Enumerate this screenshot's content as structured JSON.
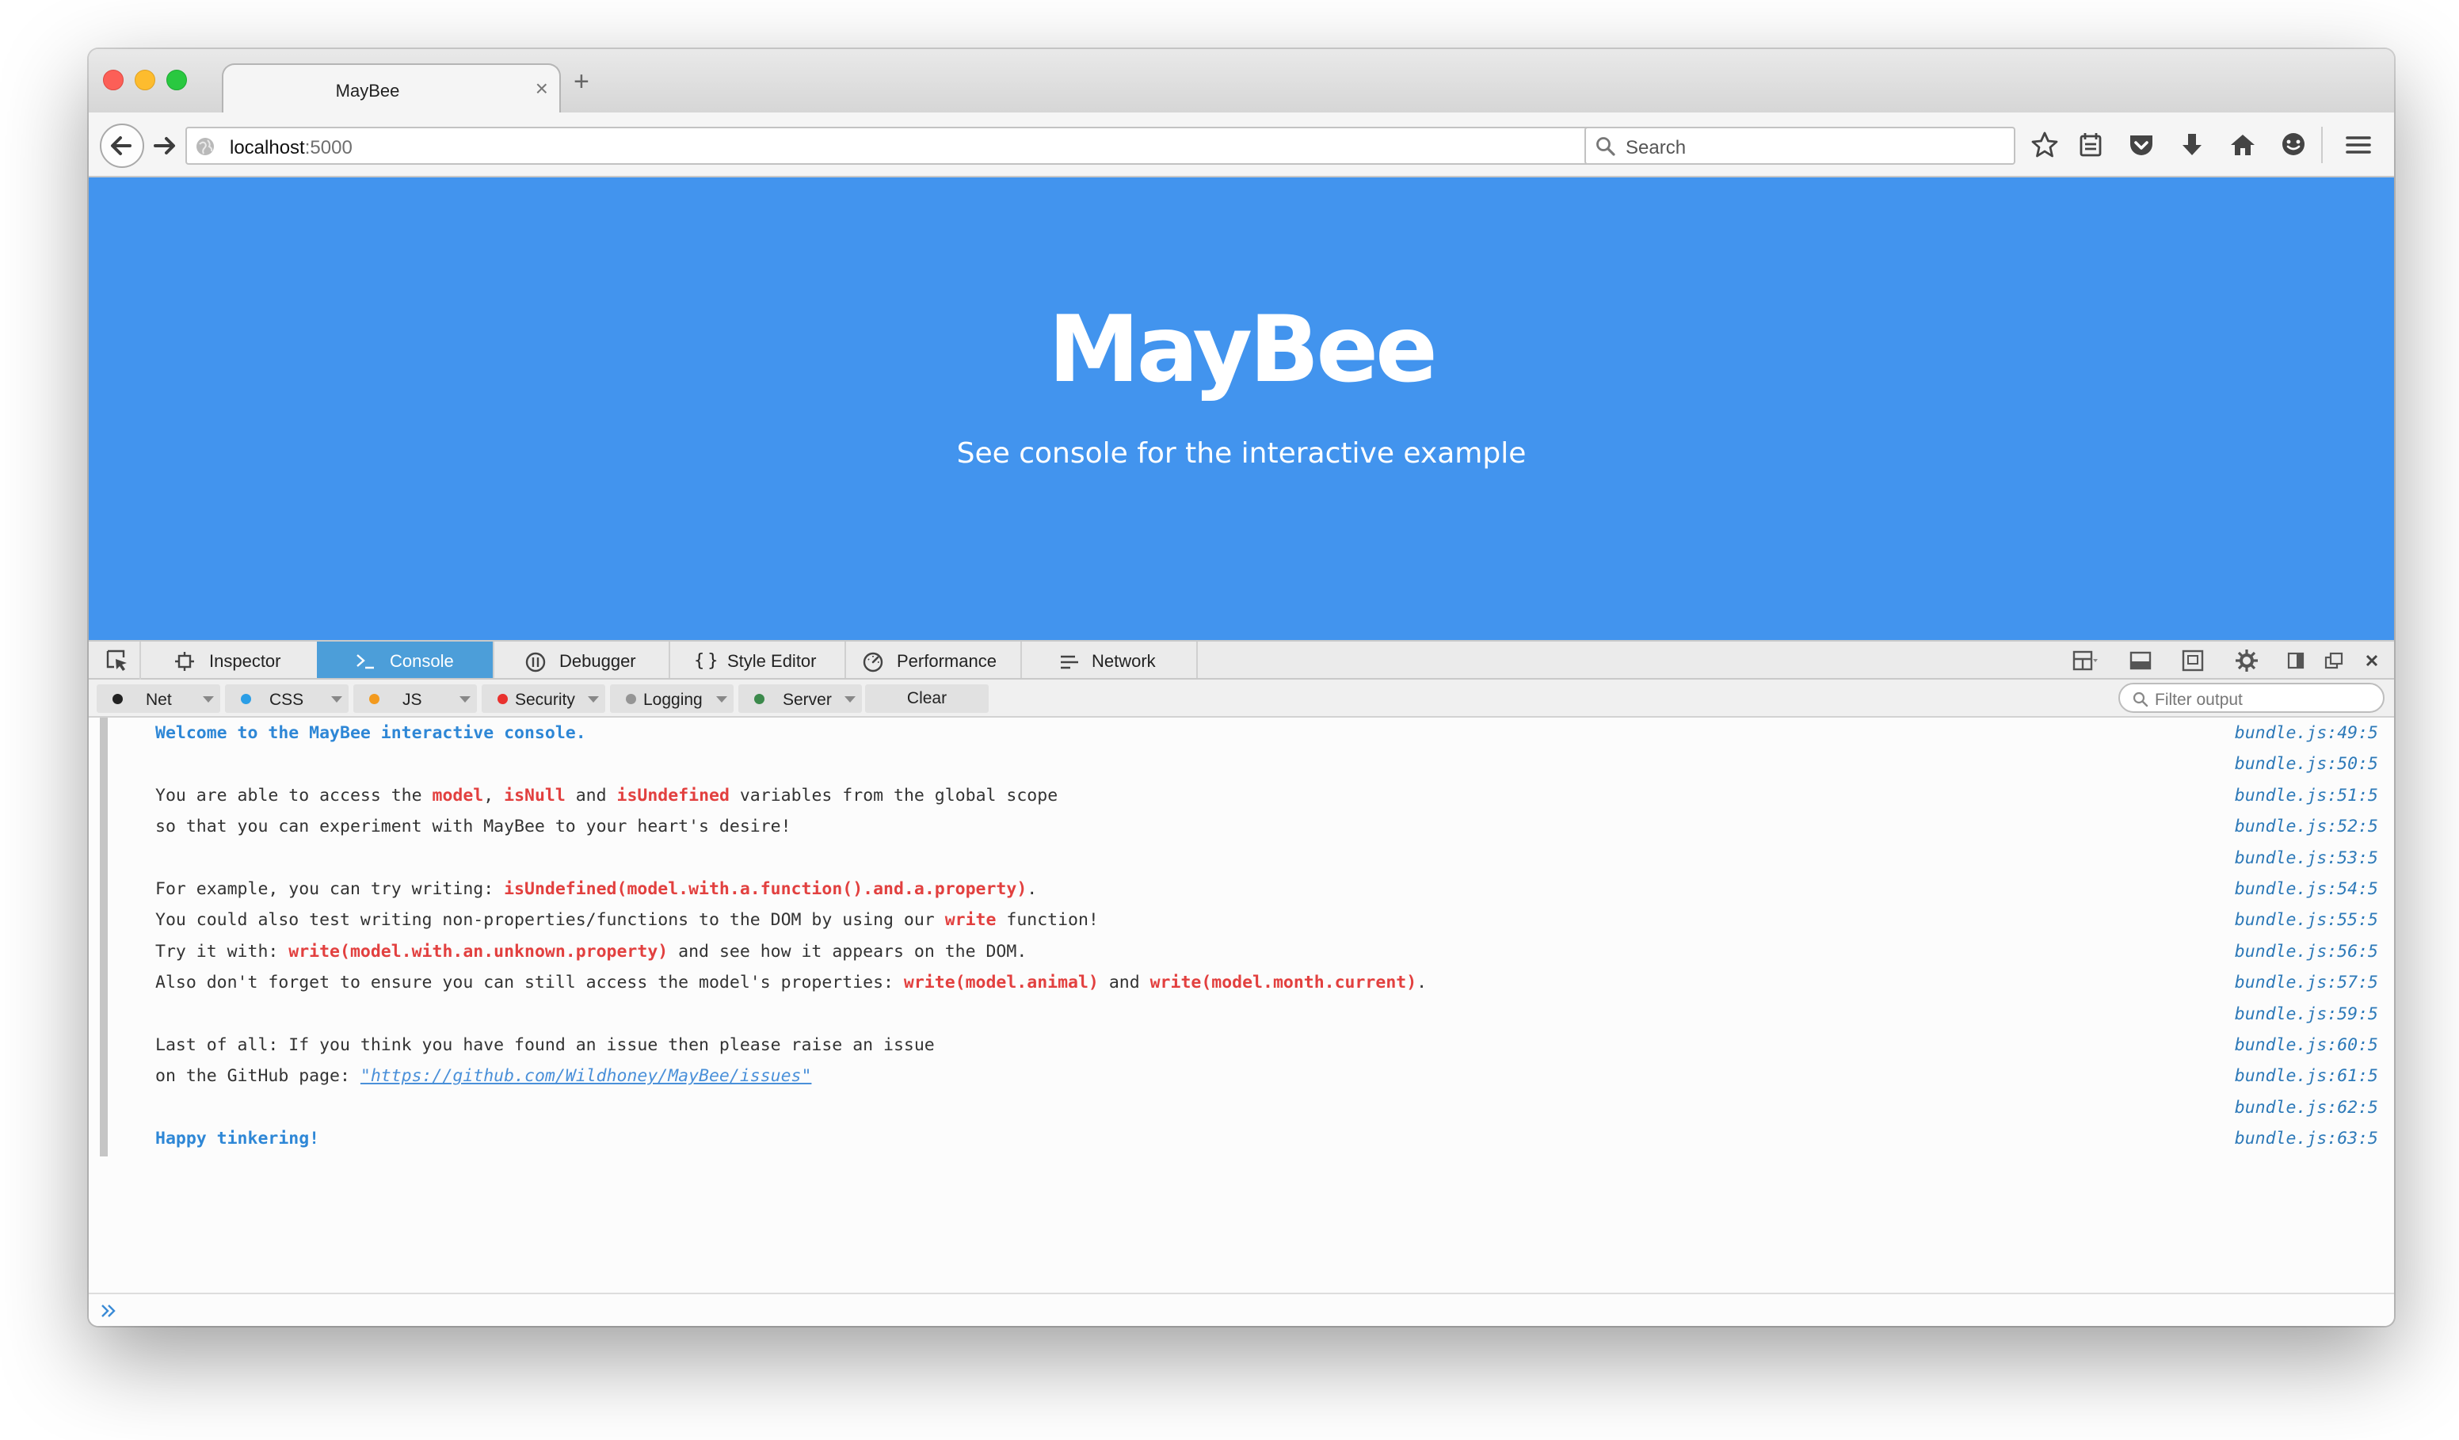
{
  "browser": {
    "tab_title": "MayBee",
    "tab_close": "×",
    "new_tab": "+",
    "url_host": "localhost",
    "url_port": ":5000",
    "search_placeholder": "Search"
  },
  "page": {
    "title": "MayBee",
    "subtitle": "See console for the interactive example"
  },
  "devtools": {
    "tabs": [
      "Inspector",
      "Console",
      "Debugger",
      "Style Editor",
      "Performance",
      "Network"
    ],
    "active_tab": "Console",
    "filters": [
      "Net",
      "CSS",
      "JS",
      "Security",
      "Logging",
      "Server"
    ],
    "clear_label": "Clear",
    "filter_placeholder": "Filter output"
  },
  "console": {
    "rows": [
      {
        "parts": [
          {
            "t": "Welcome to the MayBee interactive console.",
            "s": "blue"
          }
        ],
        "src": "bundle.js:49:5"
      },
      {
        "parts": [],
        "src": "bundle.js:50:5"
      },
      {
        "parts": [
          {
            "t": "You are able to access the "
          },
          {
            "t": "model",
            "s": "red"
          },
          {
            "t": ", "
          },
          {
            "t": "isNull",
            "s": "red"
          },
          {
            "t": " and "
          },
          {
            "t": "isUndefined",
            "s": "red"
          },
          {
            "t": " variables from the global scope"
          }
        ],
        "src": "bundle.js:51:5"
      },
      {
        "parts": [
          {
            "t": "so that you can experiment with MayBee to your heart's desire!"
          }
        ],
        "src": "bundle.js:52:5"
      },
      {
        "parts": [],
        "src": "bundle.js:53:5"
      },
      {
        "parts": [
          {
            "t": "For example, you can try writing: "
          },
          {
            "t": "isUndefined(model.with.a.function().and.a.property)",
            "s": "red"
          },
          {
            "t": "."
          }
        ],
        "src": "bundle.js:54:5"
      },
      {
        "parts": [
          {
            "t": "You could also test writing non-properties/functions to the DOM by using our "
          },
          {
            "t": "write",
            "s": "red"
          },
          {
            "t": " function!"
          }
        ],
        "src": "bundle.js:55:5"
      },
      {
        "parts": [
          {
            "t": "Try it with: "
          },
          {
            "t": "write(model.with.an.unknown.property)",
            "s": "red"
          },
          {
            "t": " and see how it appears on the DOM."
          }
        ],
        "src": "bundle.js:56:5"
      },
      {
        "parts": [
          {
            "t": "Also don't forget to ensure you can still access the model's properties: "
          },
          {
            "t": "write(model.animal)",
            "s": "red"
          },
          {
            "t": " and "
          },
          {
            "t": "write(model.month.current)",
            "s": "red"
          },
          {
            "t": "."
          }
        ],
        "src": "bundle.js:57:5"
      },
      {
        "parts": [],
        "src": "bundle.js:59:5"
      },
      {
        "parts": [
          {
            "t": "Last of all: If you think you have found an issue then please raise an issue"
          }
        ],
        "src": "bundle.js:60:5"
      },
      {
        "parts": [
          {
            "t": "on the GitHub page: "
          },
          {
            "t": "\"https://github.com/Wildhoney/MayBee/issues\"",
            "s": "link"
          }
        ],
        "src": "bundle.js:61:5"
      },
      {
        "parts": [],
        "src": "bundle.js:62:5"
      },
      {
        "parts": [
          {
            "t": "Happy tinkering!",
            "s": "blue"
          }
        ],
        "src": "bundle.js:63:5"
      }
    ]
  },
  "colors": {
    "hero_bg": "#4294ee",
    "active_tab": "#4c9ed9",
    "highlight_red": "#e2403f",
    "highlight_blue": "#2e87d6",
    "source_link": "#2d79b8"
  },
  "icons": [
    "back-arrow-icon",
    "forward-arrow-icon",
    "globe-icon",
    "reload-icon",
    "search-icon",
    "bookmark-star-icon",
    "reading-list-icon",
    "pocket-icon",
    "download-icon",
    "home-icon",
    "chat-icon",
    "hamburger-menu-icon"
  ]
}
